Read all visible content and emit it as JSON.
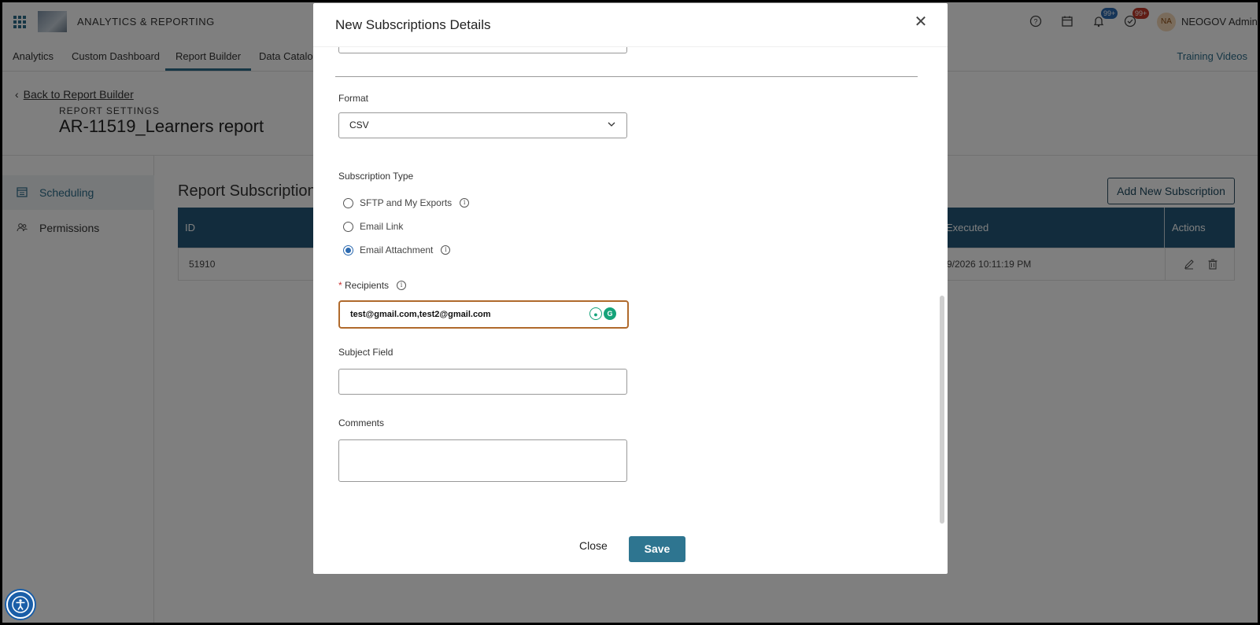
{
  "app": {
    "title": "ANALYTICS & REPORTING",
    "notification_badge": "99+",
    "tasks_badge": "99+",
    "user_initials": "NA",
    "user_name": "NEOGOV Admin"
  },
  "nav": {
    "items": [
      "Analytics",
      "Custom Dashboard",
      "Report Builder",
      "Data Catalog"
    ],
    "active": "Report Builder",
    "training_videos": "Training Videos"
  },
  "header": {
    "back_link": "Back to Report Builder",
    "section_label": "REPORT SETTINGS",
    "report_title": "AR-11519_Learners report"
  },
  "sidebar": {
    "items": [
      {
        "label": "Scheduling",
        "icon": "calendar-icon",
        "active": true
      },
      {
        "label": "Permissions",
        "icon": "users-icon",
        "active": false
      }
    ]
  },
  "main": {
    "title": "Report Subscriptions",
    "add_button": "Add New Subscription",
    "table": {
      "columns": [
        "ID",
        "Executed",
        "Actions"
      ],
      "rows": [
        {
          "id": "51910",
          "executed": "9/2026 10:11:19 PM"
        }
      ]
    }
  },
  "modal": {
    "title": "New Subscriptions Details",
    "format_label": "Format",
    "format_value": "CSV",
    "subscription_type_label": "Subscription Type",
    "subscription_types": [
      {
        "label": "SFTP and My Exports",
        "checked": false,
        "info": true
      },
      {
        "label": "Email Link",
        "checked": false,
        "info": false
      },
      {
        "label": "Email Attachment",
        "checked": true,
        "info": true
      }
    ],
    "recipients_label": "Recipients",
    "recipients_value": "test@gmail.com,test2@gmail.com",
    "subject_label": "Subject Field",
    "subject_value": "",
    "comments_label": "Comments",
    "comments_value": "",
    "close_button": "Close",
    "save_button": "Save"
  },
  "colors": {
    "primary": "#2c6c8a",
    "table_header": "#24597a",
    "save_button": "#2e7590",
    "focus_border": "#b06a2c"
  }
}
